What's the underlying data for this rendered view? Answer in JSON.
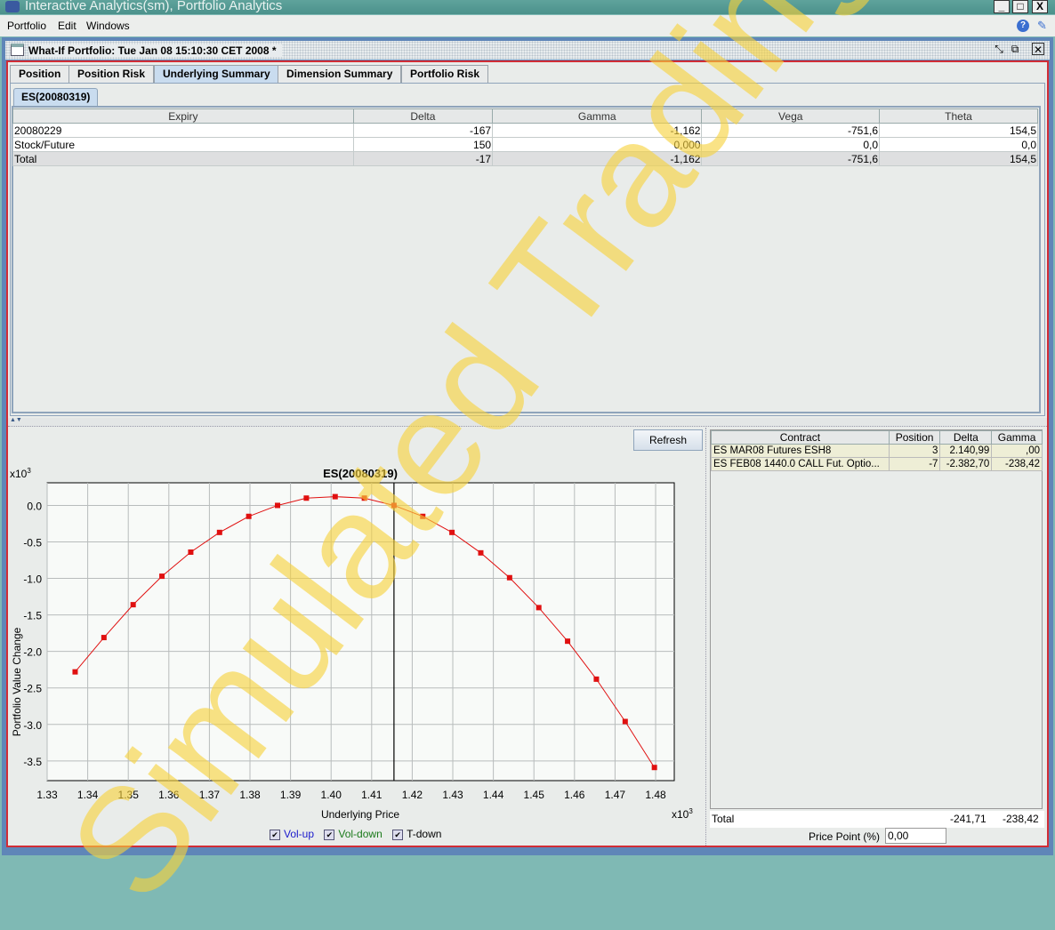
{
  "window": {
    "title": "Interactive Analytics(sm), Portfolio Analytics",
    "controls": [
      "_",
      "□",
      "X"
    ]
  },
  "menu": [
    "Portfolio",
    "Edit",
    "Windows"
  ],
  "frame": {
    "title": "What-If Portfolio: Tue Jan 08 15:10:30 CET 2008  *"
  },
  "tabs": [
    {
      "label": "Position"
    },
    {
      "label": "Position Risk"
    },
    {
      "label": "Underlying Summary",
      "active": true
    },
    {
      "label": "Dimension Summary"
    },
    {
      "label": "Portfolio Risk"
    }
  ],
  "subtab": "ES(20080319)",
  "summary": {
    "headers": [
      "Expiry",
      "Delta",
      "Gamma",
      "Vega",
      "Theta"
    ],
    "rows": [
      [
        "20080229",
        "-167",
        "-1,162",
        "-751,6",
        "154,5"
      ],
      [
        "Stock/Future",
        "150",
        "0,000",
        "0,0",
        "0,0"
      ],
      [
        "Total",
        "-17",
        "-1,162",
        "-751,6",
        "154,5"
      ]
    ]
  },
  "refresh_label": "Refresh",
  "contracts": {
    "headers": [
      "Contract",
      "Position",
      "Delta",
      "Gamma"
    ],
    "rows": [
      [
        "ES MAR08 Futures ESH8",
        "3",
        "2.140,99",
        ",00"
      ],
      [
        "ES FEB08 1440.0 CALL Fut. Optio...",
        "-7",
        "-2.382,70",
        "-238,42"
      ]
    ],
    "total_label": "Total",
    "total_delta": "-241,71",
    "total_gamma": "-238,42"
  },
  "price_point": {
    "label": "Price Point (%)",
    "value": "0,00"
  },
  "legend": [
    {
      "label": "Vol-up",
      "color": "#1a1acc",
      "checked": true
    },
    {
      "label": "Vol-down",
      "color": "#1a7a1a",
      "checked": true
    },
    {
      "label": "T-down",
      "color": "#000000",
      "checked": true
    }
  ],
  "watermark": "Simulated Trading",
  "chart_data": {
    "type": "line",
    "title": "ES(20080319)",
    "xlabel": "Underlying Price",
    "ylabel": "Portfolio Value Change",
    "x_multiplier": "x10^3",
    "y_multiplier": "x10^3",
    "xlim": [
      1.33,
      1.4846
    ],
    "ylim": [
      -3.77,
      0.31
    ],
    "xticks": [
      "1.33",
      "1.34",
      "1.35",
      "1.36",
      "1.37",
      "1.38",
      "1.39",
      "1.40",
      "1.41",
      "1.42",
      "1.43",
      "1.44",
      "1.45",
      "1.46",
      "1.47",
      "1.48"
    ],
    "yticks": [
      "0.0",
      "-0.5",
      "-1.0",
      "-1.5",
      "-2.0",
      "-2.5",
      "-3.0",
      "-3.5"
    ],
    "grid": true,
    "current_price": 1.4155,
    "series_color": "#e01010",
    "x": [
      1.3369,
      1.344,
      1.3512,
      1.3583,
      1.3654,
      1.3725,
      1.3797,
      1.3868,
      1.3939,
      1.401,
      1.4082,
      1.4155,
      1.4226,
      1.4298,
      1.4369,
      1.444,
      1.4512,
      1.4583,
      1.4654,
      1.4725,
      1.4797
    ],
    "y": [
      -2.28,
      -1.81,
      -1.36,
      -0.97,
      -0.64,
      -0.37,
      -0.15,
      0.0,
      0.1,
      0.12,
      0.1,
      0.0,
      -0.15,
      -0.37,
      -0.65,
      -0.99,
      -1.4,
      -1.86,
      -2.38,
      -2.96,
      -3.59
    ]
  }
}
